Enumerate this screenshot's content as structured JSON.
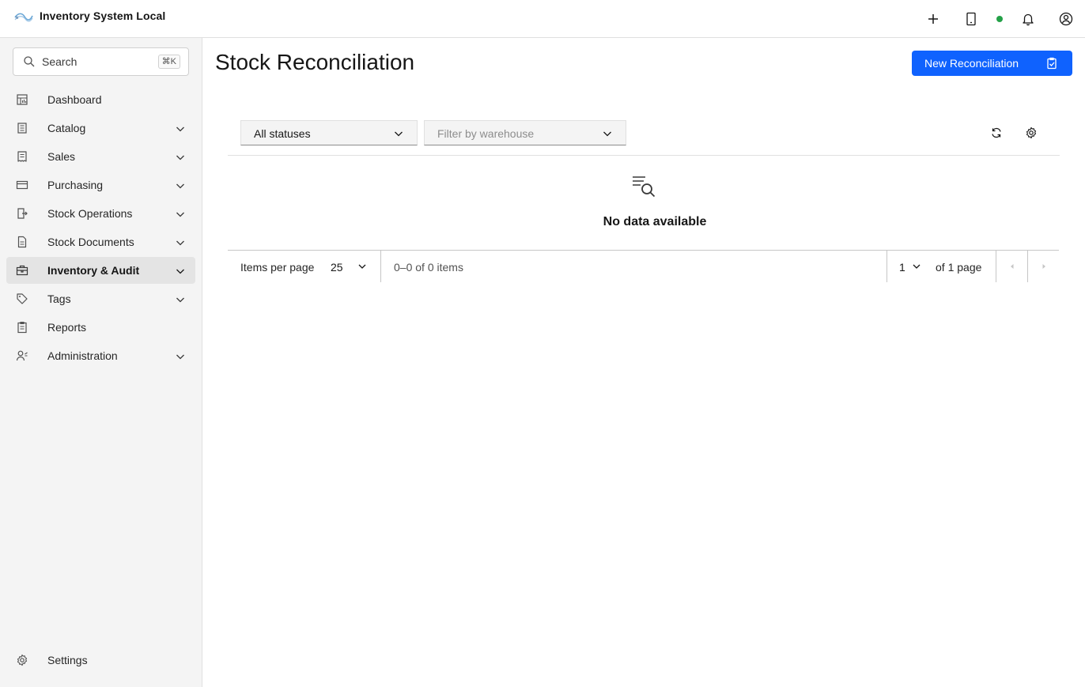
{
  "header": {
    "app_title": "Inventory System Local",
    "icons": [
      "add-icon",
      "tablet-icon",
      "status-dot",
      "notification-icon",
      "user-avatar-icon"
    ],
    "status_color": "#24a148"
  },
  "sidebar": {
    "search": {
      "placeholder": "Search",
      "shortcut": "⌘K"
    },
    "items": [
      {
        "label": "Dashboard",
        "icon": "dashboard-icon",
        "expandable": false
      },
      {
        "label": "Catalog",
        "icon": "catalog-icon",
        "expandable": true
      },
      {
        "label": "Sales",
        "icon": "receipt-icon",
        "expandable": true
      },
      {
        "label": "Purchasing",
        "icon": "credit-card-icon",
        "expandable": true
      },
      {
        "label": "Stock Operations",
        "icon": "transfer-icon",
        "expandable": true
      },
      {
        "label": "Stock Documents",
        "icon": "document-icon",
        "expandable": true
      },
      {
        "label": "Inventory & Audit",
        "icon": "audit-icon",
        "expandable": true,
        "active": true
      },
      {
        "label": "Tags",
        "icon": "tag-icon",
        "expandable": true
      },
      {
        "label": "Reports",
        "icon": "report-icon",
        "expandable": false
      },
      {
        "label": "Administration",
        "icon": "user-admin-icon",
        "expandable": true
      }
    ],
    "settings_label": "Settings"
  },
  "main": {
    "title": "Stock Reconciliation",
    "primary_button": "New Reconciliation",
    "filters": {
      "status": "All statuses",
      "warehouse_placeholder": "Filter by warehouse"
    },
    "empty_state": "No data available",
    "pagination": {
      "items_per_page_label": "Items per page",
      "page_size": "25",
      "range": "0–0 of 0 items",
      "current_page": "1",
      "of_pages": "of 1 page"
    }
  },
  "colors": {
    "accent": "#0f62fe",
    "sidebar_bg": "#f4f4f4",
    "active_item_bg": "#e4e4e4"
  }
}
